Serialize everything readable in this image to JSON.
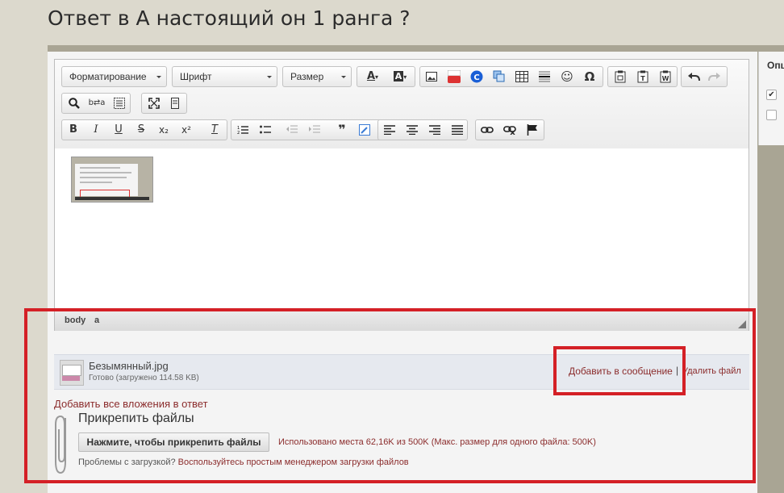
{
  "page": {
    "title": "Ответ в А настоящий он 1 ранга ?"
  },
  "side_panel": {
    "label": "Опц"
  },
  "toolbar": {
    "format_label": "Форматирование",
    "font_label": "Шрифт",
    "size_label": "Размер",
    "icons": {
      "text_color": "A",
      "bg_color": "A",
      "find": "⌕",
      "replace": "b⇄a",
      "bold": "B",
      "italic": "I",
      "underline": "U",
      "strike": "S",
      "subscript": "x₂",
      "superscript": "x²",
      "remove_format": "T",
      "quote": "❞",
      "symbol": "Ω",
      "smiley": "☺"
    }
  },
  "status_bar": {
    "path_body": "body",
    "path_a": "a"
  },
  "attachment": {
    "file_name": "Безымянный.jpg",
    "status": "Готово (загружено 114.58 KB)",
    "add_link": "Добавить в сообщение",
    "separator": "|",
    "delete_link": "Удалить файл"
  },
  "attachments_footer": {
    "add_all": "Добавить все вложения в ответ",
    "title": "Прикрепить файлы",
    "upload_button": "Нажмите, чтобы прикрепить файлы",
    "usage": "Использовано места 62,16K из 500K (Макс. размер для одного файла: 500K)",
    "problems_text": "Проблемы с загрузкой?",
    "problems_link": "Воспользуйтесь простым менеджером загрузки файлов"
  },
  "colors": {
    "highlight": "#d42026",
    "link": "#8b2c2c",
    "background": "#dcd9cd"
  }
}
